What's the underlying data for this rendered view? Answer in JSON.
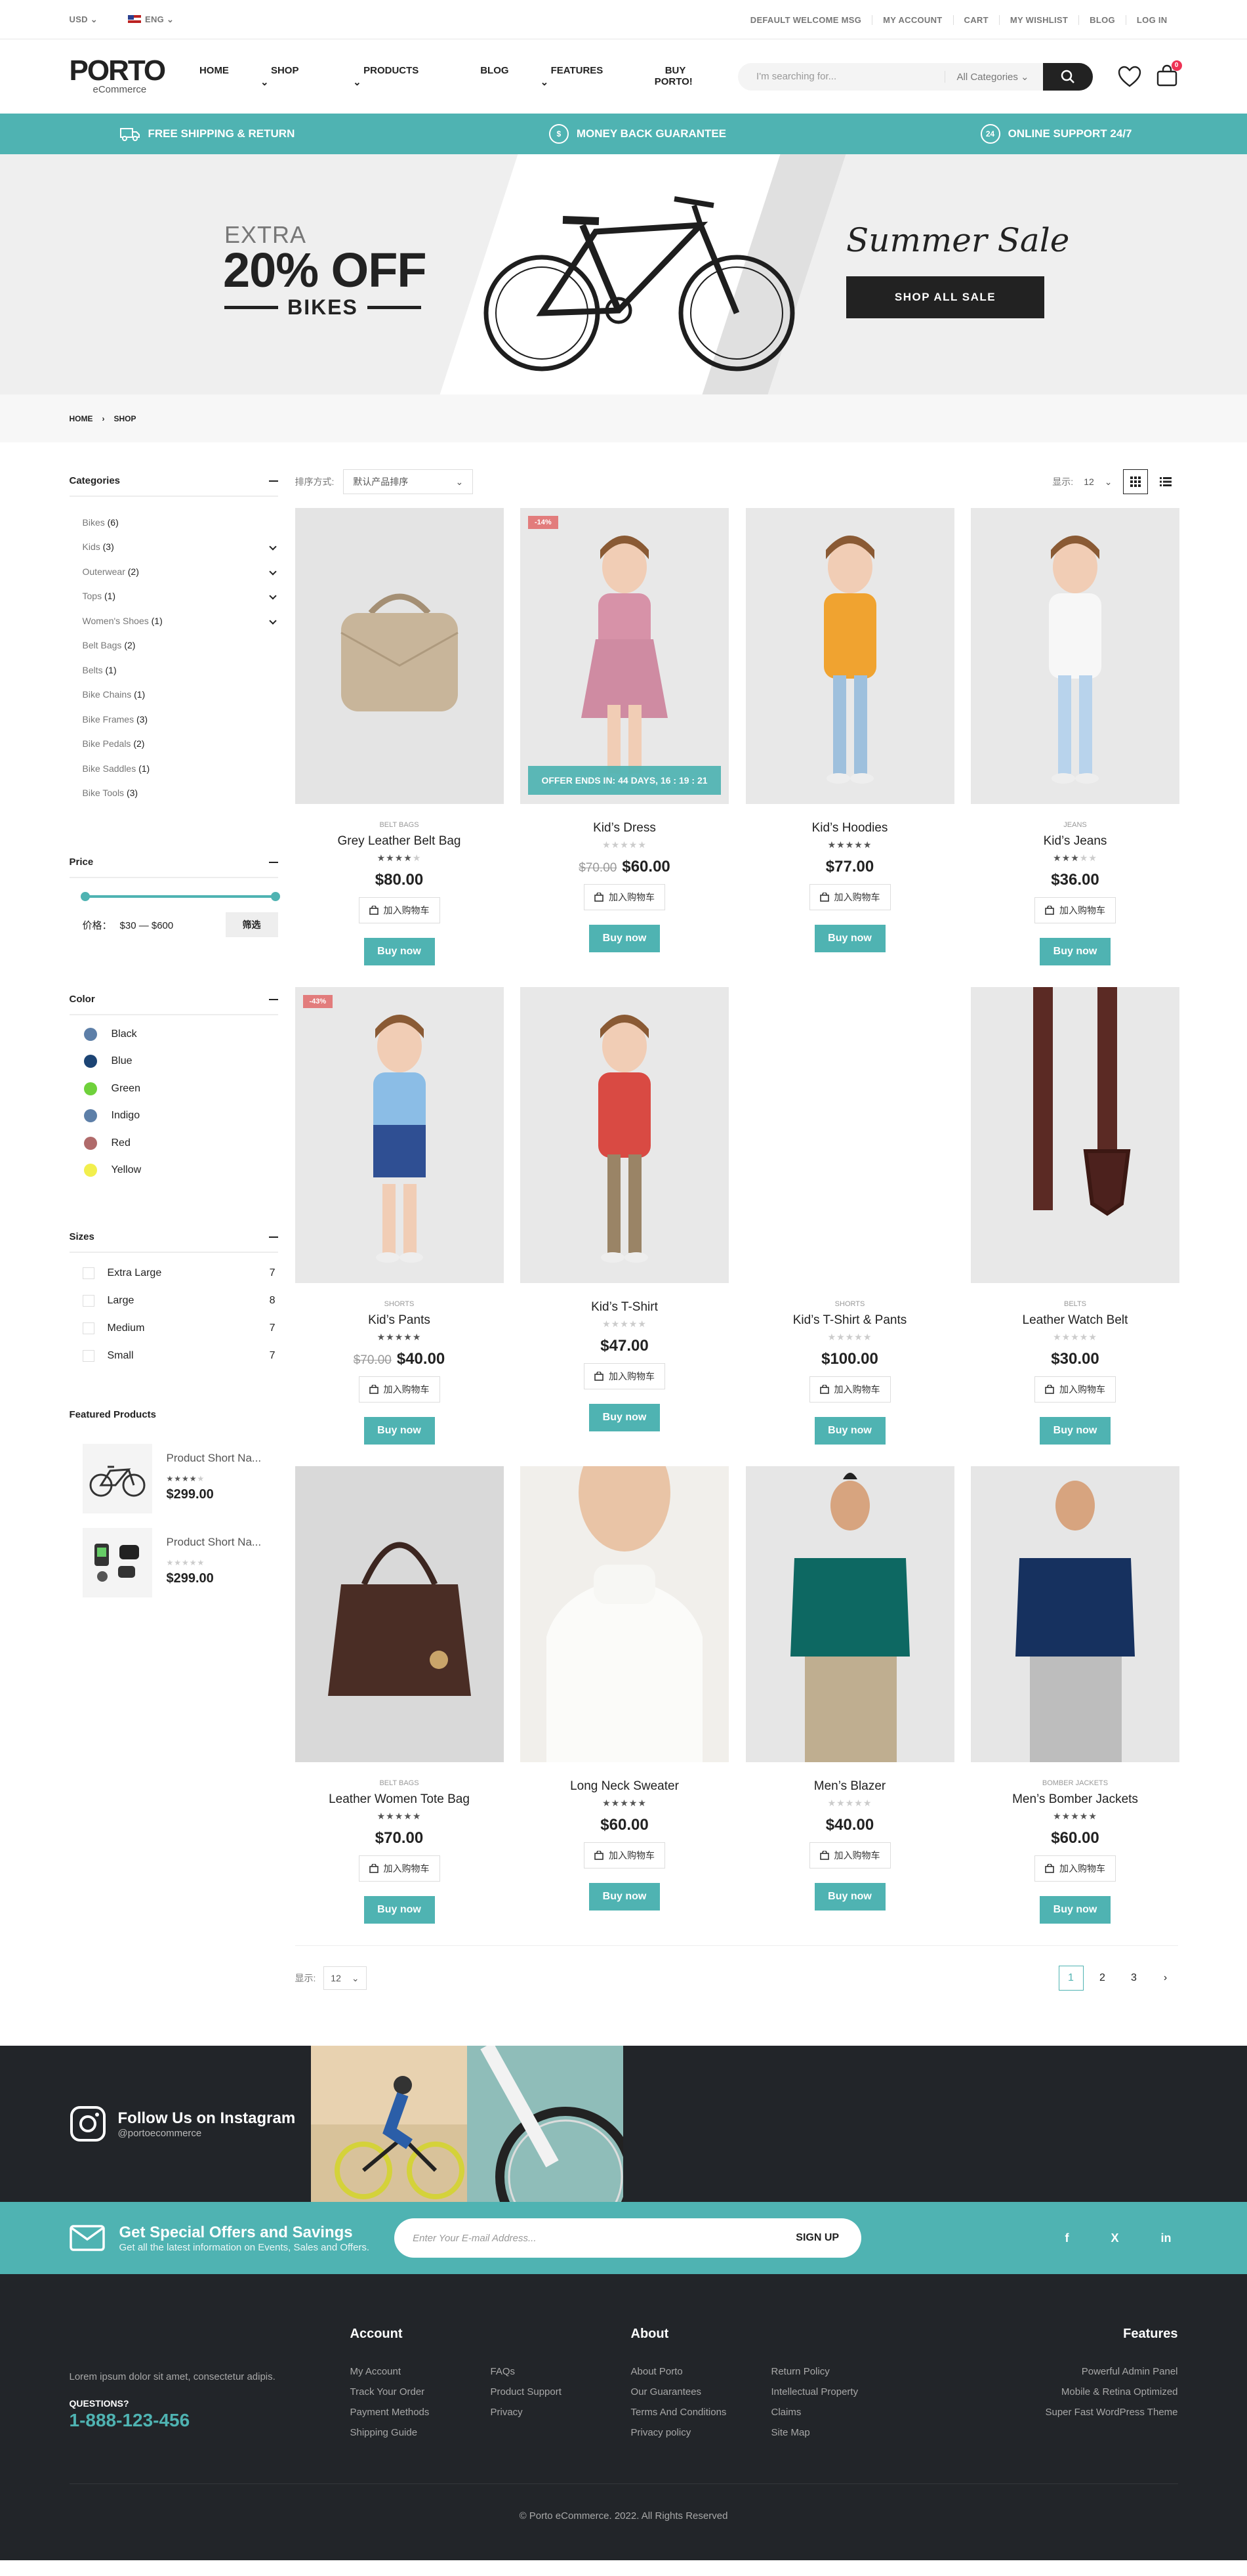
{
  "topbar": {
    "currency": "USD",
    "language": "ENG",
    "links": [
      "DEFAULT WELCOME MSG",
      "MY ACCOUNT",
      "CART",
      "MY WISHLIST",
      "BLOG",
      "LOG IN"
    ]
  },
  "header": {
    "logo": "PORTO",
    "logo_sub": "eCommerce",
    "nav": [
      "HOME",
      "SHOP",
      "PRODUCTS",
      "BLOG",
      "FEATURES",
      "BUY PORTO!"
    ],
    "search_placeholder": "I'm searching for...",
    "search_category": "All Categories",
    "cart_count": "0"
  },
  "promo": [
    "FREE SHIPPING & RETURN",
    "MONEY BACK GUARANTEE",
    "ONLINE SUPPORT 24/7"
  ],
  "hero": {
    "extra": "EXTRA",
    "off": "20% OFF",
    "bikes": "BIKES",
    "summer": "Summer Sale",
    "button": "SHOP ALL SALE"
  },
  "breadcrumb": [
    "HOME",
    "SHOP"
  ],
  "sidebar": {
    "categories_title": "Categories",
    "categories": [
      {
        "name": "Bikes",
        "count": "(6)",
        "expand": false
      },
      {
        "name": "Kids",
        "count": "(3)",
        "expand": true
      },
      {
        "name": "Outerwear",
        "count": "(2)",
        "expand": true
      },
      {
        "name": "Tops",
        "count": "(1)",
        "expand": true
      },
      {
        "name": "Women's Shoes",
        "count": "(1)",
        "expand": true
      },
      {
        "name": "Belt Bags",
        "count": "(2)",
        "expand": false
      },
      {
        "name": "Belts",
        "count": "(1)",
        "expand": false
      },
      {
        "name": "Bike Chains",
        "count": "(1)",
        "expand": false
      },
      {
        "name": "Bike Frames",
        "count": "(3)",
        "expand": false
      },
      {
        "name": "Bike Pedals",
        "count": "(2)",
        "expand": false
      },
      {
        "name": "Bike Saddles",
        "count": "(1)",
        "expand": false
      },
      {
        "name": "Bike Tools",
        "count": "(3)",
        "expand": false
      }
    ],
    "price_title": "Price",
    "price_label": "价格：",
    "price_range": "$30 — $600",
    "filter_btn": "筛选",
    "color_title": "Color",
    "colors": [
      {
        "name": "Black",
        "hex": "#5d7fa8"
      },
      {
        "name": "Blue",
        "hex": "#1c4474"
      },
      {
        "name": "Green",
        "hex": "#6fd13b"
      },
      {
        "name": "Indigo",
        "hex": "#5d7fa8"
      },
      {
        "name": "Red",
        "hex": "#b06a6a"
      },
      {
        "name": "Yellow",
        "hex": "#f2ef4d"
      }
    ],
    "sizes_title": "Sizes",
    "sizes": [
      {
        "name": "Extra Large",
        "count": "7"
      },
      {
        "name": "Large",
        "count": "8"
      },
      {
        "name": "Medium",
        "count": "7"
      },
      {
        "name": "Small",
        "count": "7"
      }
    ],
    "featured_title": "Featured Products",
    "featured": [
      {
        "name": "Product Short Na...",
        "price": "$299.00",
        "rating": 4
      },
      {
        "name": "Product Short Na...",
        "price": "$299.00",
        "rating": 0
      }
    ]
  },
  "toolbar": {
    "sort_label": "排序方式:",
    "sort_value": "默认产品排序",
    "show_label": "显示:",
    "show_value": "12"
  },
  "products": [
    {
      "cat": "BELT BAGS",
      "name": "Grey Leather Belt Bag",
      "rating": 4,
      "old": "",
      "price": "$80.00",
      "badge": "",
      "timer": "",
      "img": "bag"
    },
    {
      "cat": "",
      "name": "Kid’s Dress",
      "rating": 0,
      "old": "$70.00",
      "price": "$60.00",
      "badge": "-14%",
      "timer": "OFFER ENDS IN: 44 DAYS, 16 : 19 : 21",
      "img": "girl-pink"
    },
    {
      "cat": "",
      "name": "Kid’s Hoodies",
      "rating": 5,
      "old": "",
      "price": "$77.00",
      "badge": "",
      "timer": "",
      "img": "girl-orange"
    },
    {
      "cat": "JEANS",
      "name": "Kid’s Jeans",
      "rating": 3,
      "old": "",
      "price": "$36.00",
      "badge": "",
      "timer": "",
      "img": "girl-white"
    },
    {
      "cat": "SHORTS",
      "name": "Kid’s Pants",
      "rating": 5,
      "old": "$70.00",
      "price": "$40.00",
      "badge": "-43%",
      "timer": "",
      "img": "girl-blue"
    },
    {
      "cat": "",
      "name": "Kid’s T-Shirt",
      "rating": 0,
      "old": "",
      "price": "$47.00",
      "badge": "",
      "timer": "",
      "img": "boy-red"
    },
    {
      "cat": "SHORTS",
      "name": "Kid’s T-Shirt & Pants",
      "rating": 0,
      "old": "",
      "price": "$100.00",
      "badge": "",
      "timer": "",
      "img": "none"
    },
    {
      "cat": "BELTS",
      "name": "Leather Watch Belt",
      "rating": 0,
      "old": "",
      "price": "$30.00",
      "badge": "",
      "timer": "",
      "img": "belt"
    },
    {
      "cat": "BELT BAGS",
      "name": "Leather Women Tote Bag",
      "rating": 5,
      "old": "",
      "price": "$70.00",
      "badge": "",
      "timer": "",
      "img": "tote"
    },
    {
      "cat": "",
      "name": "Long Neck Sweater",
      "rating": 5,
      "old": "",
      "price": "$60.00",
      "badge": "",
      "timer": "",
      "img": "sweater"
    },
    {
      "cat": "",
      "name": "Men’s Blazer",
      "rating": 0,
      "old": "",
      "price": "$40.00",
      "badge": "",
      "timer": "",
      "img": "polo-green"
    },
    {
      "cat": "BOMBER JACKETS",
      "name": "Men’s Bomber Jackets",
      "rating": 5,
      "old": "",
      "price": "$60.00",
      "badge": "",
      "timer": "",
      "img": "polo-navy"
    }
  ],
  "card_labels": {
    "add_to_cart": "加入购物车",
    "buy_now": "Buy now"
  },
  "pager": {
    "show_label": "显示:",
    "show_value": "12",
    "pages": [
      "1",
      "2",
      "3"
    ]
  },
  "instagram": {
    "title": "Follow Us on Instagram",
    "handle": "@portoecommerce"
  },
  "newsletter": {
    "title": "Get Special Offers and Savings",
    "subtitle": "Get all the latest information on Events, Sales and Offers.",
    "placeholder": "Enter Your E-mail Address...",
    "button": "SIGN UP",
    "social": [
      "f",
      "X",
      "in"
    ]
  },
  "footer": {
    "tagline": "Lorem ipsum dolor sit amet, consectetur adipis.",
    "questions": "QUESTIONS?",
    "phone": "1-888-123-456",
    "account_title": "Account",
    "account_a": [
      "My Account",
      "Track Your Order",
      "Payment Methods",
      "Shipping Guide"
    ],
    "account_b": [
      "FAQs",
      "Product Support",
      "Privacy"
    ],
    "about_title": "About",
    "about_a": [
      "About Porto",
      "Our Guarantees",
      "Terms And Conditions",
      "Privacy policy"
    ],
    "about_b": [
      "Return Policy",
      "Intellectual Property",
      "Claims",
      "Site Map"
    ],
    "features_title": "Features",
    "features": [
      "Powerful Admin Panel",
      "Mobile & Retina Optimized",
      "Super Fast WordPress Theme"
    ],
    "copyright": "© Porto eCommerce. 2022. All Rights Reserved"
  }
}
